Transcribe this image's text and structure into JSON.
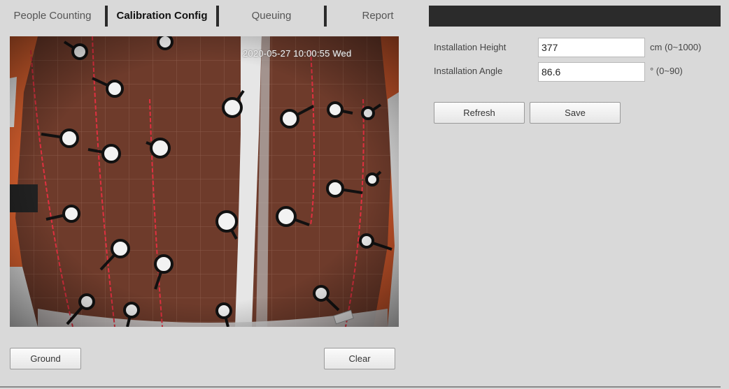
{
  "tabs": [
    {
      "label": "People Counting",
      "active": false
    },
    {
      "label": "Calibration Config",
      "active": true
    },
    {
      "label": "Queuing",
      "active": false
    },
    {
      "label": "Report",
      "active": false
    }
  ],
  "video": {
    "timestamp": "2020-05-27 10:00:55 Wed"
  },
  "buttons": {
    "ground": "Ground",
    "clear": "Clear",
    "refresh": "Refresh",
    "save": "Save"
  },
  "form": {
    "height_label": "Installation Height",
    "height_value": "377",
    "height_unit": "cm (0~1000)",
    "angle_label": "Installation Angle",
    "angle_value": "86.6",
    "angle_unit": "° (0~90)"
  },
  "colors": {
    "tab_bar": "#2b2b2b",
    "background": "#d9d9d9",
    "floor": "#6a3a2a",
    "calibration_line": "#e03040"
  }
}
